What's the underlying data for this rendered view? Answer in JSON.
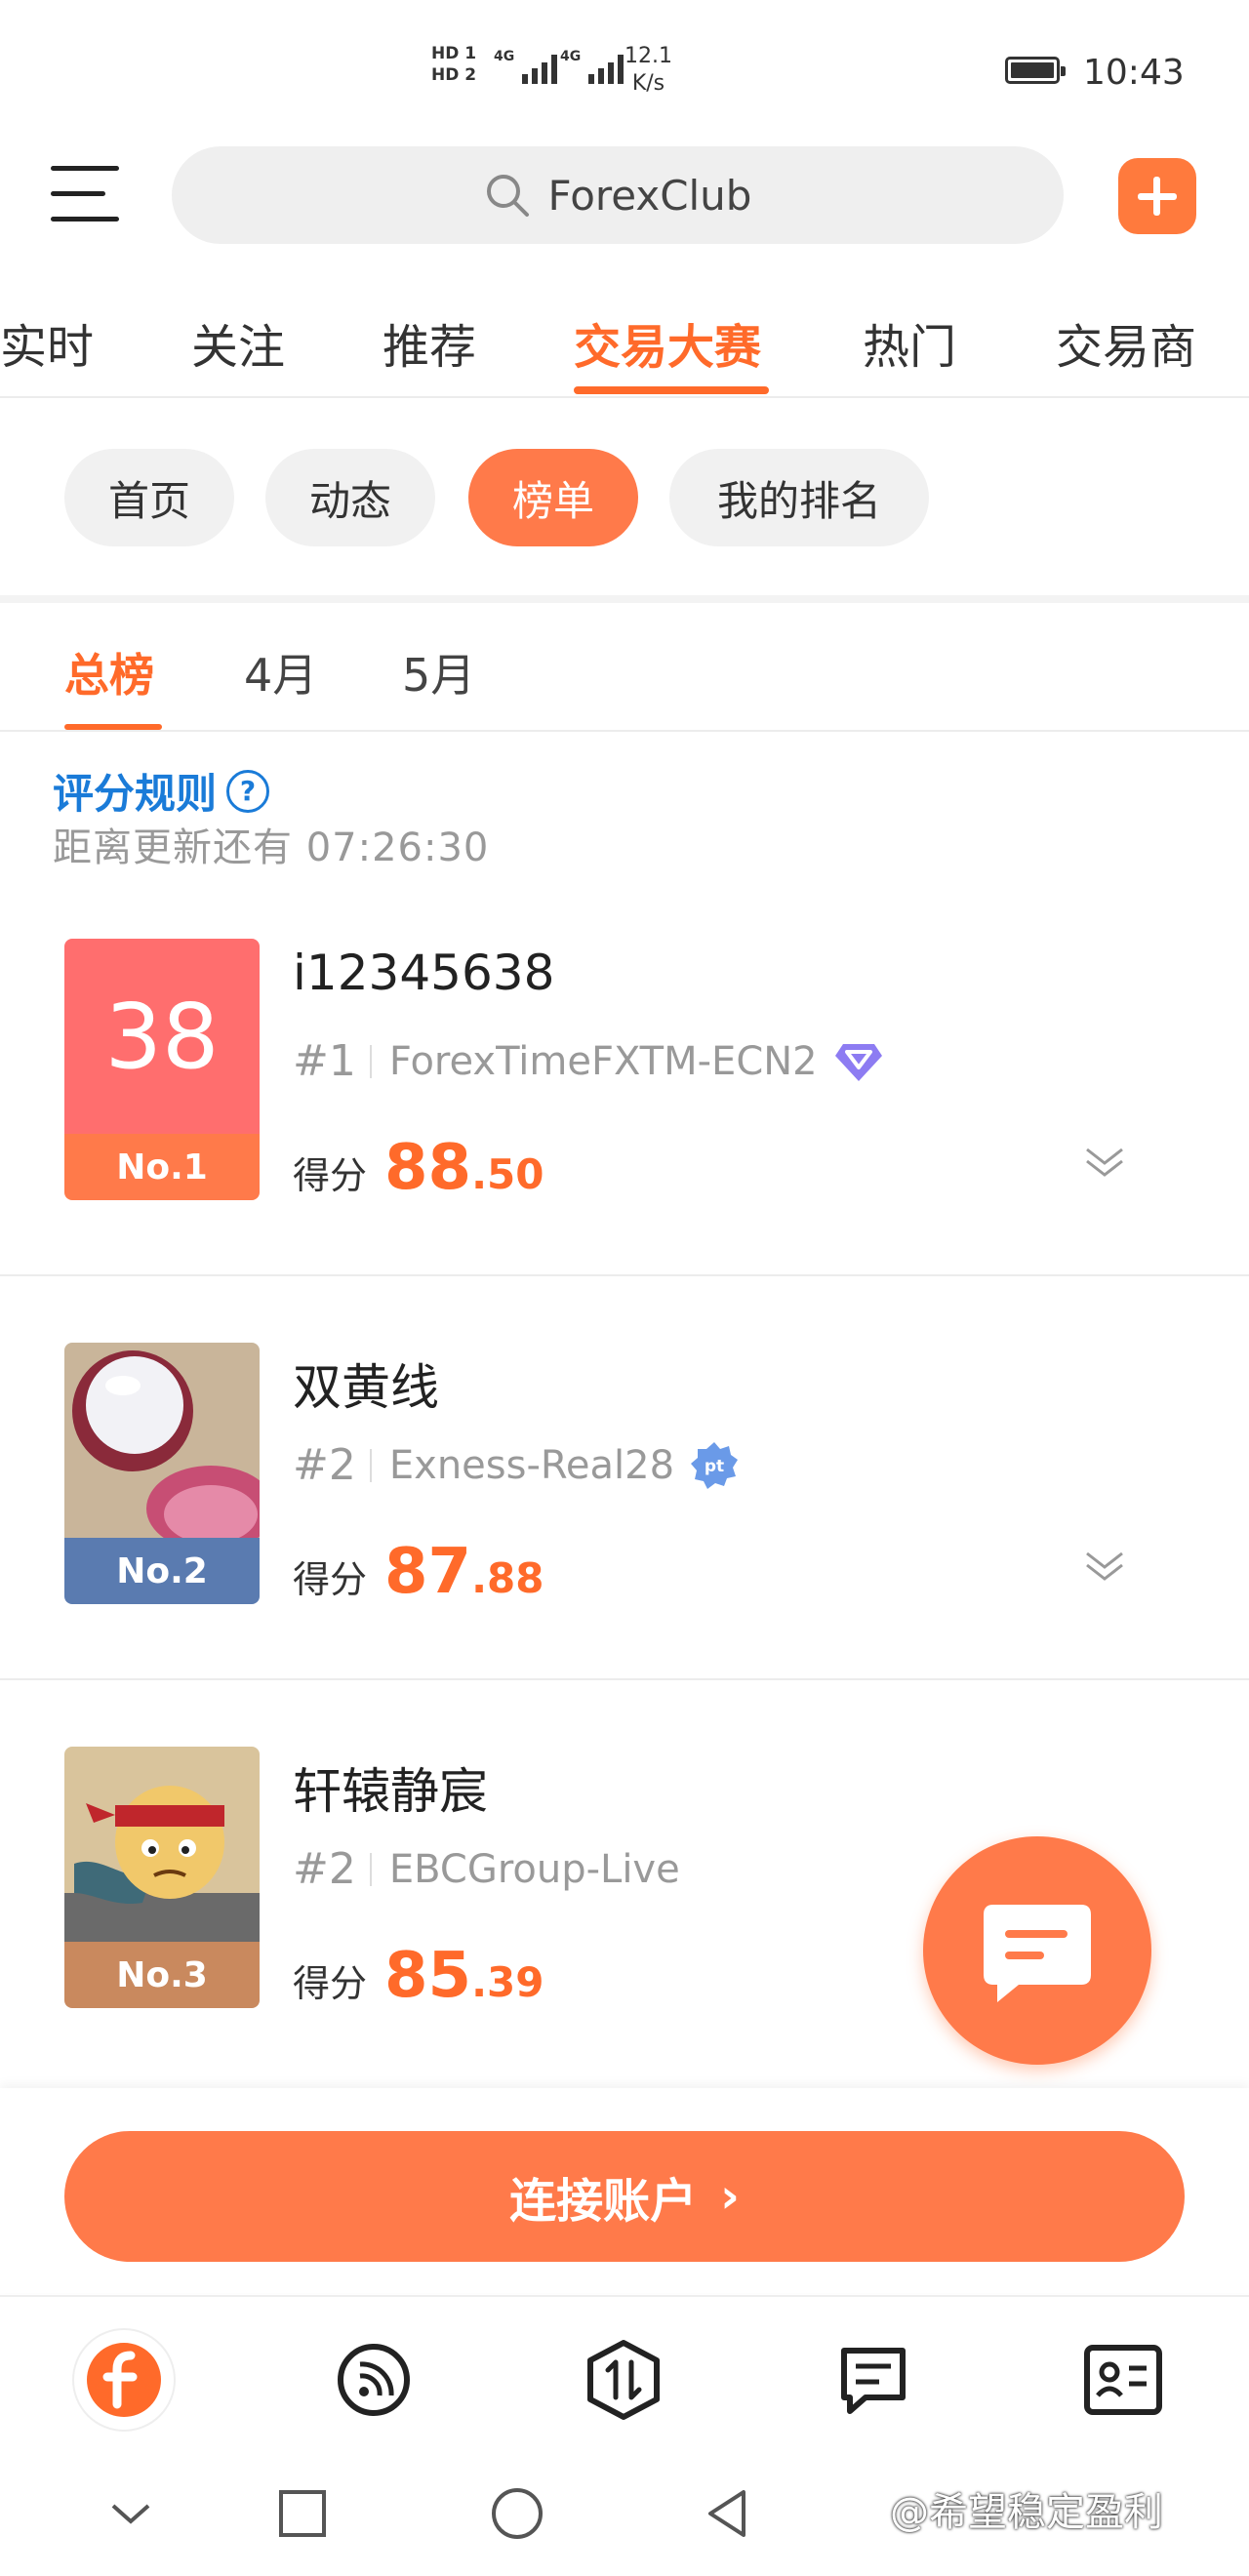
{
  "status_bar": {
    "sim1": "HD 1",
    "sim2": "HD 2",
    "net1": "4G",
    "net2": "4G",
    "speed_value": "12.1",
    "speed_unit": "K/s",
    "time": "10:43"
  },
  "header": {
    "search_text": "ForexClub"
  },
  "top_tabs": [
    {
      "label": "实时"
    },
    {
      "label": "关注"
    },
    {
      "label": "推荐"
    },
    {
      "label": "交易大赛",
      "active": true
    },
    {
      "label": "热门"
    },
    {
      "label": "交易商"
    }
  ],
  "chips": [
    {
      "label": "首页"
    },
    {
      "label": "动态"
    },
    {
      "label": "榜单",
      "active": true
    },
    {
      "label": "我的排名"
    }
  ],
  "sub_tabs": [
    {
      "label": "总榜",
      "active": true
    },
    {
      "label": "4月"
    },
    {
      "label": "5月"
    }
  ],
  "rules": {
    "link": "评分规则",
    "help_glyph": "?",
    "countdown": "距离更新还有 07:26:30"
  },
  "ranking": [
    {
      "avatar_text": "38",
      "rank_label": "No.1",
      "name": "i12345638",
      "rank": "#1",
      "broker": "ForexTimeFXTM-ECN2",
      "badge": "diamond-badge-icon",
      "score_label": "得分",
      "score_int": "88",
      "score_dec": ".50"
    },
    {
      "rank_label": "No.2",
      "name": "双黄线",
      "rank": "#2",
      "broker": "Exness-Real28",
      "badge": "pt-badge-icon",
      "badge_text": "pt",
      "score_label": "得分",
      "score_int": "87",
      "score_dec": ".88"
    },
    {
      "rank_label": "No.3",
      "name": "轩辕静宸",
      "rank": "#2",
      "broker": "EBCGroup-Live",
      "score_label": "得分",
      "score_int": "85",
      "score_dec": ".39"
    }
  ],
  "connect_button": {
    "label": "连接账户",
    "arrow": "›"
  },
  "bottom_nav": [
    {
      "icon": "forexclub-home-icon"
    },
    {
      "icon": "feed-icon"
    },
    {
      "icon": "trade-exchange-icon"
    },
    {
      "icon": "messages-icon"
    },
    {
      "icon": "profile-card-icon"
    }
  ],
  "watermark": "@希望稳定盈利",
  "colors": {
    "accent": "#ff6a2a",
    "rank1": "#ff7a4a",
    "rank2": "#5a7bb0",
    "rank3": "#c9895e",
    "link": "#1a7bd8"
  }
}
